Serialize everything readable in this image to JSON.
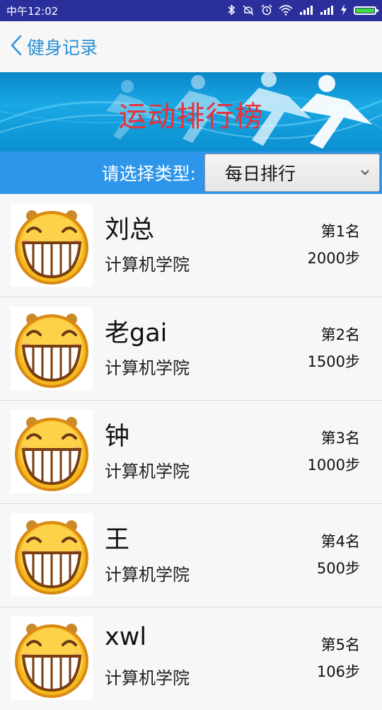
{
  "status_bar": {
    "time": "中午12:02",
    "icons": [
      "bluetooth-icon",
      "mute-icon",
      "alarm-icon",
      "wifi-icon",
      "signal-icon",
      "signal-icon",
      "charging-icon",
      "battery-icon"
    ],
    "battery_level": 1.0
  },
  "header": {
    "back_label": "健身记录"
  },
  "banner": {
    "title": "运动排行榜"
  },
  "selector": {
    "label": "请选择类型:",
    "selected": "每日排行"
  },
  "colors": {
    "status_bar": "#2b2f9c",
    "accent_blue": "#2a8fd6",
    "selector_bg": "#2e96ea",
    "banner_title": "#e8303a"
  },
  "rankings": [
    {
      "name": "刘总",
      "college": "计算机学院",
      "rank": "第1名",
      "steps": "2000步"
    },
    {
      "name": "老gai",
      "college": "计算机学院",
      "rank": "第2名",
      "steps": "1500步"
    },
    {
      "name": "钟",
      "college": "计算机学院",
      "rank": "第3名",
      "steps": "1000步"
    },
    {
      "name": "王",
      "college": "计算机学院",
      "rank": "第4名",
      "steps": "500步"
    },
    {
      "name": "xwl",
      "college": "计算机学院",
      "rank": "第5名",
      "steps": "106步"
    }
  ]
}
